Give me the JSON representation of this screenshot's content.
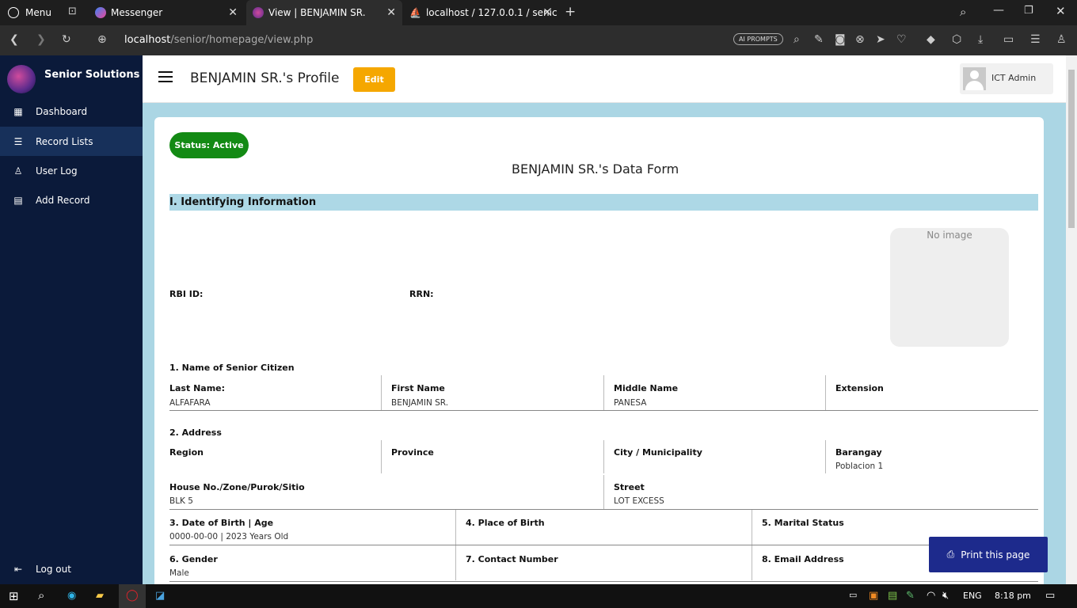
{
  "browser": {
    "menu_label": "Menu",
    "tabs": [
      {
        "label": "Messenger"
      },
      {
        "label": "View | BENJAMIN SR."
      },
      {
        "label": "localhost / 127.0.0.1 / senic"
      }
    ],
    "url_host": "localhost",
    "url_path": "/senior/homepage/view.php",
    "ai_prompts": "AI PROMPTS"
  },
  "sidebar": {
    "brand": "Senior Solutions",
    "items": [
      {
        "label": "Dashboard"
      },
      {
        "label": "Record Lists"
      },
      {
        "label": "User Log"
      },
      {
        "label": "Add Record"
      }
    ],
    "logout": "Log out"
  },
  "header": {
    "title": "BENJAMIN SR.'s Profile",
    "edit_label": "Edit",
    "user_name": "ICT Admin"
  },
  "form": {
    "status": "Status: Active",
    "title": "BENJAMIN SR.'s Data Form",
    "section1": "I. Identifying Information",
    "photo_placeholder": "No image",
    "rbi_id_label": "RBI ID:",
    "rrn_label": "RRN:",
    "name_section": "1. Name of Senior Citizen",
    "last_name_label": "Last Name:",
    "last_name": "ALFAFARA",
    "first_name_label": "First Name",
    "first_name": "BENJAMIN SR.",
    "middle_name_label": "Middle Name",
    "middle_name": "PANESA",
    "extension_label": "Extension",
    "address_section": "2. Address",
    "region_label": "Region",
    "province_label": "Province",
    "city_label": "City / Municipality",
    "barangay_label": "Barangay",
    "barangay": "Poblacion 1",
    "house_label": "House No./Zone/Purok/Sitio",
    "house": "BLK 5",
    "street_label": "Street",
    "street": "LOT EXCESS",
    "dob_label": "3. Date of Birth | Age",
    "dob": "0000-00-00 | 2023 Years Old",
    "pob_label": "4. Place of Birth",
    "marital_label": "5. Marital Status",
    "gender_label": "6. Gender",
    "gender": "Male",
    "contact_label": "7. Contact Number",
    "email_label": "8. Email Address"
  },
  "print_label": "Print this page",
  "taskbar": {
    "lang": "ENG",
    "time": "8:18 pm"
  }
}
